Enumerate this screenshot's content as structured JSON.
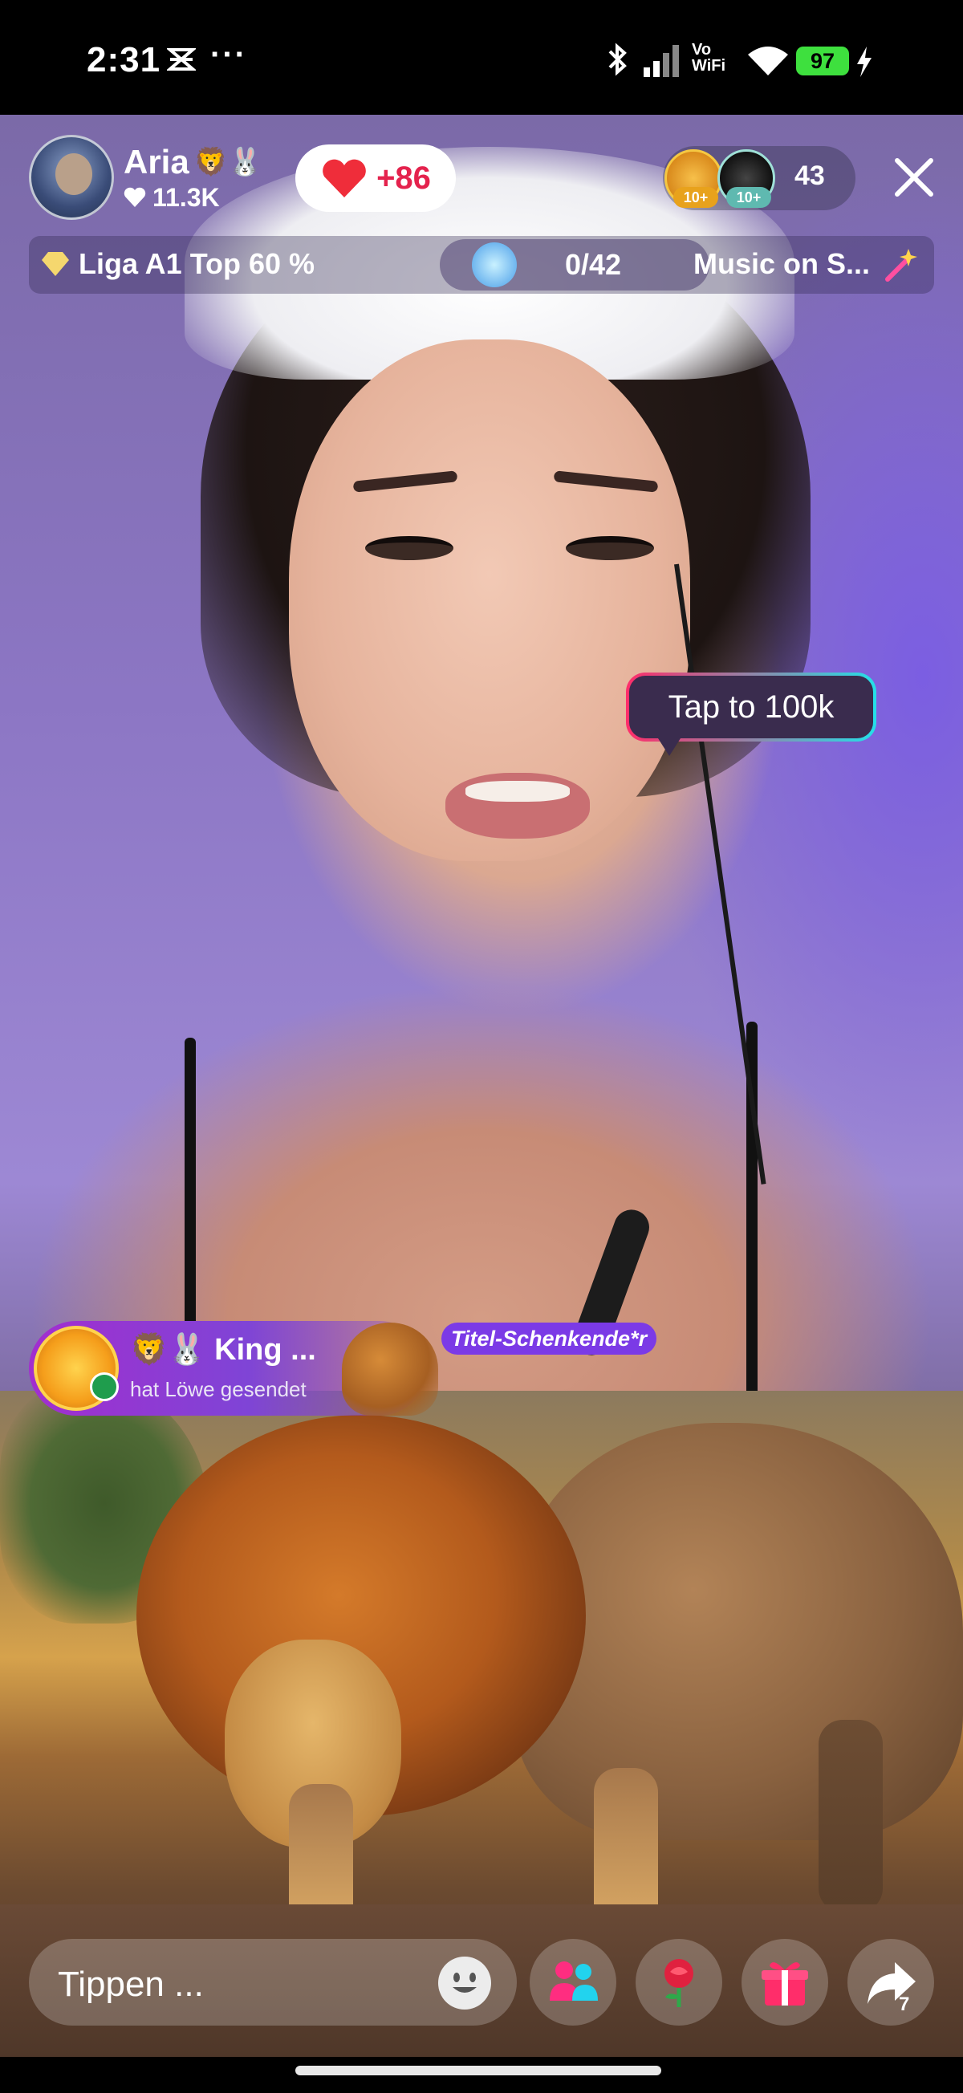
{
  "status_bar": {
    "time": "2:31",
    "more": "···",
    "vowifi_line1": "Vo",
    "vowifi_line2": "WiFi",
    "battery": "97",
    "icons": [
      "notification-icon",
      "bluetooth-icon",
      "signal-icon",
      "wifi-icon",
      "battery-icon",
      "charging-icon"
    ]
  },
  "host": {
    "name": "Aria",
    "name_emoji": "🦁🐰",
    "likes": "11.3K"
  },
  "like_button": {
    "label": "+86",
    "color": "#e4224d"
  },
  "viewers": {
    "badges": [
      "10+",
      "10+"
    ],
    "count": "43"
  },
  "info_bar": {
    "league": "Liga A1 Top 60 %",
    "goal_progress": "0/42",
    "goal_current": 0,
    "goal_target": 42,
    "music": "Music on S..."
  },
  "tip_bubble": {
    "text": "Tap to 100k"
  },
  "gift_notification": {
    "sender": "🦁🐰 King ...",
    "action": "hat Löwe  gesendet",
    "tag": "Titel-Schenkende*r"
  },
  "bottom_bar": {
    "comment_placeholder": "Tippen ...",
    "share_count": "7",
    "buttons": [
      "emoji-icon",
      "people-icon",
      "rose-icon",
      "gift-icon",
      "share-icon"
    ]
  },
  "colors": {
    "accent_pink": "#ff2d6a",
    "accent_cyan": "#23e0e8",
    "battery_green": "#3ee03e",
    "gift_purple": "#7b3ae6"
  }
}
